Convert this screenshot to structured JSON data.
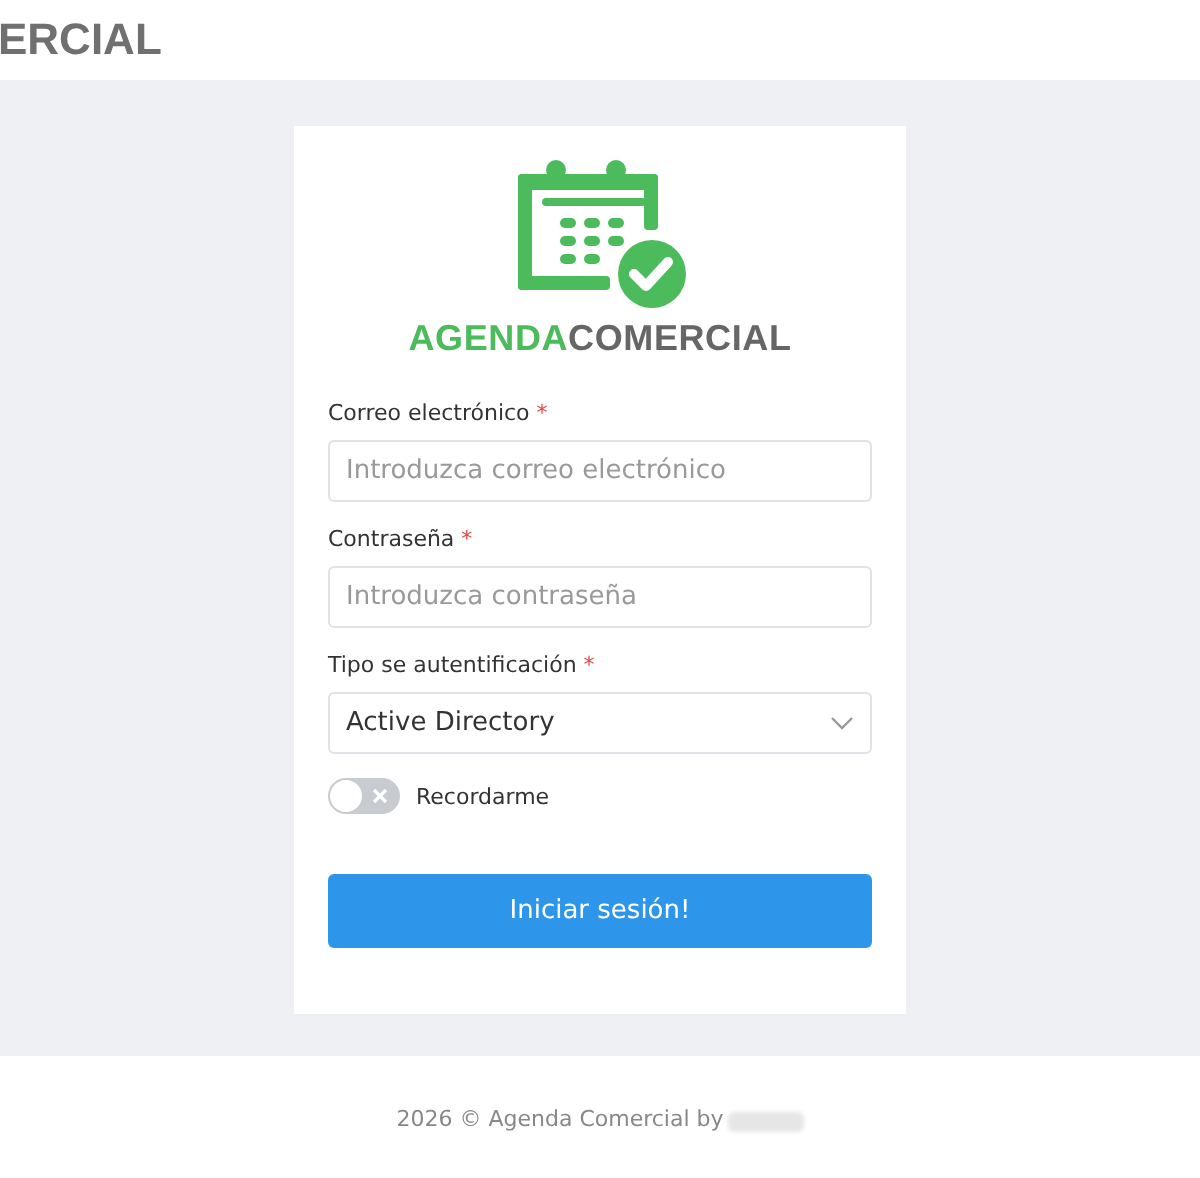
{
  "header": {
    "brand": "ERCIAL"
  },
  "logo": {
    "brand_primary": "AGENDA",
    "brand_secondary": "COMERCIAL"
  },
  "form": {
    "fields": [
      {
        "kind": "text",
        "label": "Correo electrónico",
        "required_mark": "*",
        "placeholder": "Introduzca correo electrónico"
      },
      {
        "kind": "password",
        "label": "Contraseña",
        "required_mark": "*",
        "placeholder": "Introduzca contraseña"
      },
      {
        "kind": "select",
        "label": "Tipo se autentificación",
        "required_mark": "*",
        "value": "Active Directory"
      }
    ],
    "remember": {
      "label": "Recordarme",
      "on": false
    },
    "submit": "Iniciar sesión!"
  },
  "footer": {
    "text": "2026 © Agenda Comercial by"
  }
}
